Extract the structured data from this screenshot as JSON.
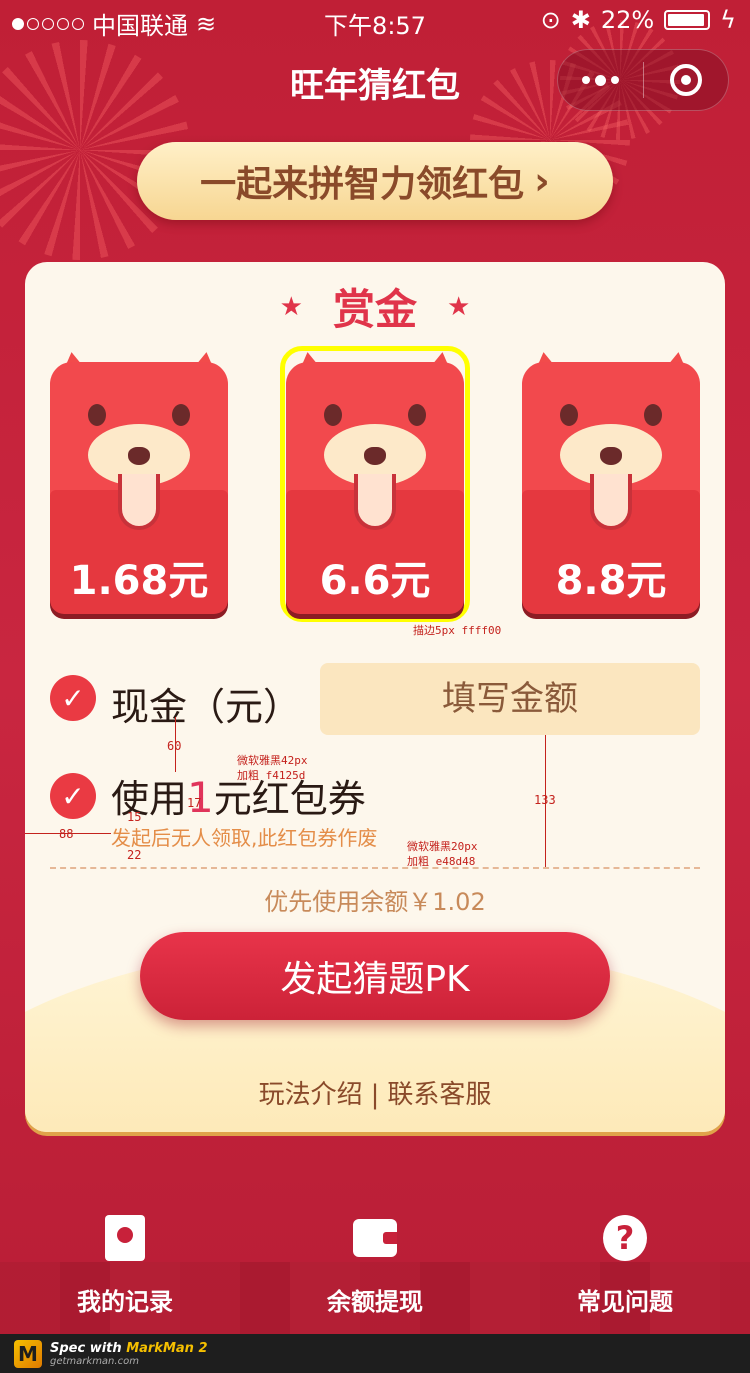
{
  "status": {
    "carrier": "中国联通",
    "time": "下午8:57",
    "battery": "22%"
  },
  "nav": {
    "title": "旺年猜红包"
  },
  "banner": {
    "label": "一起来拼智力领红包",
    "chevron": "›"
  },
  "card": {
    "title": "赏金",
    "amounts": [
      "1.68元",
      "6.6元",
      "8.8元"
    ],
    "selected_index": 1,
    "stroke_note": "描边5px ffff00",
    "cash_label": "现金（元）",
    "amount_placeholder": "填写金额",
    "coupon_prefix": "使用",
    "coupon_count": "1",
    "coupon_suffix": "元红包券",
    "coupon_note": "发起后无人领取,此红包券作废",
    "balance": "优先使用余额￥1.02",
    "pk_button": "发起猜题PK",
    "link_intro": "玩法介绍",
    "link_separator": "|",
    "link_service": "联系客服"
  },
  "annotations": {
    "font1_a": "微软雅黑42px",
    "font1_b": "加粗 f4125d",
    "font2_a": "微软雅黑20px",
    "font2_b": "加粗 e48d48",
    "m60": "60",
    "m17": "17",
    "m15": "15",
    "m22": "22",
    "m88": "88",
    "m133": "133"
  },
  "tabs": [
    {
      "label": "我的记录",
      "icon": "record-book-icon"
    },
    {
      "label": "余额提现",
      "icon": "wallet-icon"
    },
    {
      "label": "常见问题",
      "icon": "question-icon"
    }
  ],
  "footer": {
    "brand_prefix": "Spec with",
    "brand": "MarkMan 2",
    "site": "getmarkman.com"
  },
  "colors": {
    "accent": "#e0344a",
    "coupon": "#f4125d",
    "note": "#e48d48",
    "highlight": "#ffff00"
  }
}
